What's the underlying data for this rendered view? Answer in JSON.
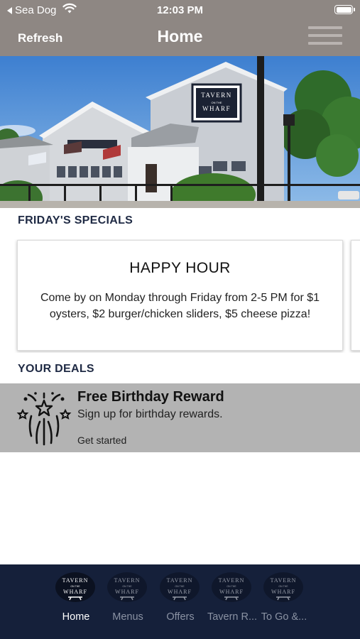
{
  "status_bar": {
    "back_app": "Sea Dog",
    "time": "12:03 PM"
  },
  "header": {
    "refresh_label": "Refresh",
    "title": "Home"
  },
  "hero": {
    "sign_line1": "TAVERN",
    "sign_line2": "ON THE",
    "sign_line3": "WHARF"
  },
  "specials": {
    "section_label": "FRIDAY'S SPECIALS",
    "cards": [
      {
        "title": "HAPPY HOUR",
        "text": "Come by on Monday through Friday from 2-5 PM for $1 oysters, $2 burger/chicken sliders, $5 cheese pizza!"
      }
    ]
  },
  "deals": {
    "section_label": "YOUR DEALS",
    "items": [
      {
        "title": "Free Birthday Reward",
        "subtitle": "Sign up for birthday rewards.",
        "cta": "Get started",
        "icon": "fireworks-icon"
      }
    ]
  },
  "tabbar": {
    "logo_line1": "TAVERN",
    "logo_line2": "ON THE",
    "logo_line3": "WHARF",
    "tabs": [
      {
        "label": "Home",
        "active": true
      },
      {
        "label": "Menus",
        "active": false
      },
      {
        "label": "Offers",
        "active": false
      },
      {
        "label": "Tavern R...",
        "active": false
      },
      {
        "label": "To Go &...",
        "active": false
      }
    ]
  },
  "colors": {
    "header_bg": "#8e8783",
    "tabbar_bg": "#15203a",
    "section_label": "#1f2a44",
    "deal_bg": "#b3b3b3"
  }
}
